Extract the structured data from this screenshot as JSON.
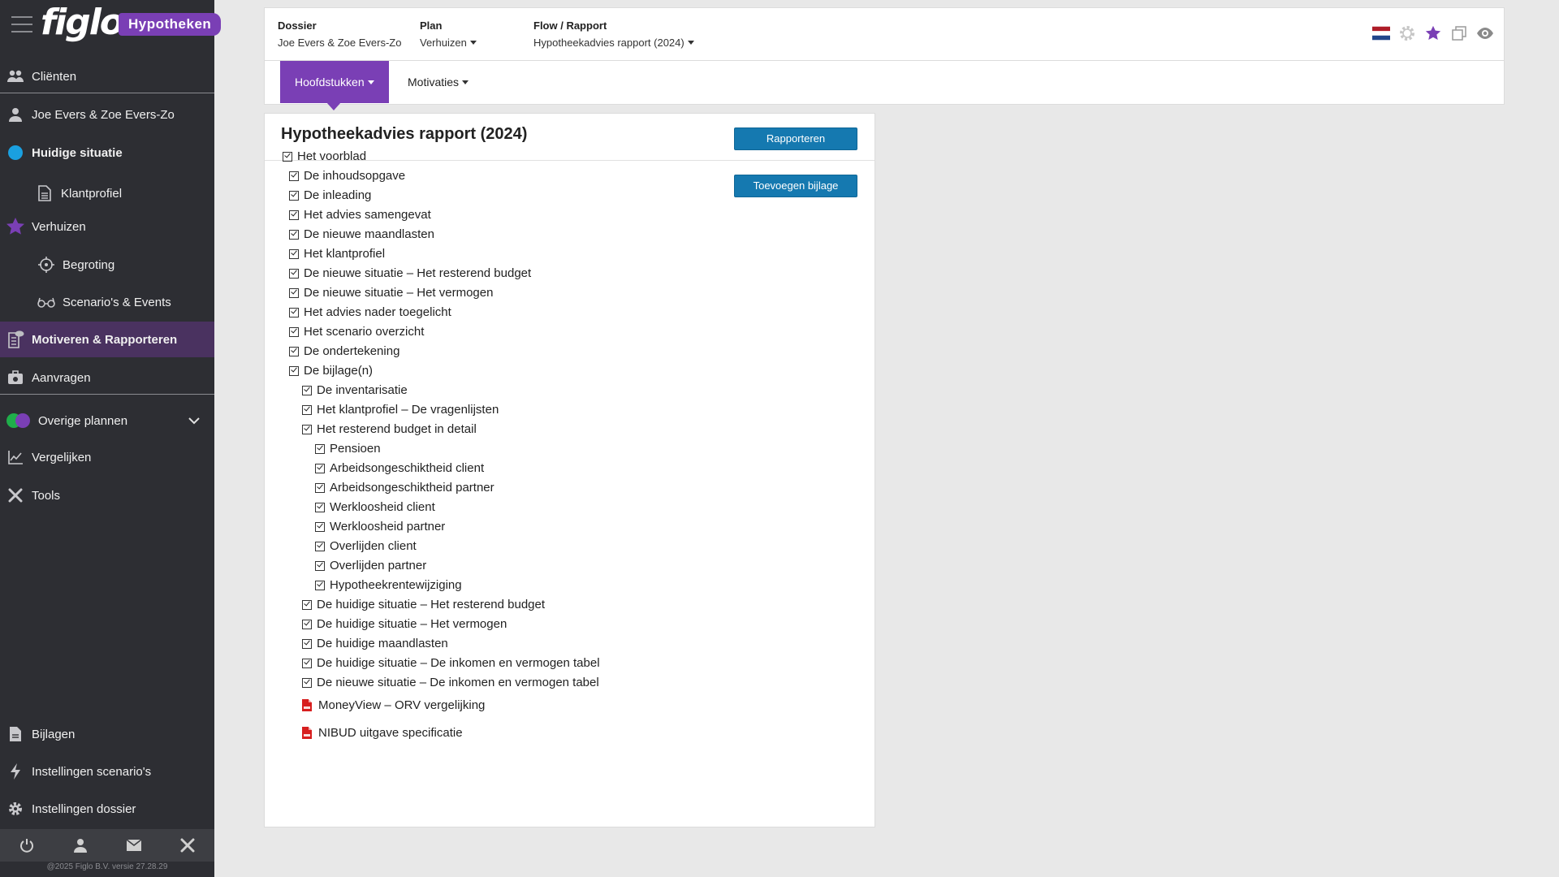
{
  "app": {
    "logo": "figlo",
    "product_badge": "Hypotheken",
    "copyright": "@2025 Figlo B.V. versie 27.28.29"
  },
  "sidebar": {
    "items": [
      {
        "label": "Cliënten",
        "icon": "users-icon"
      },
      {
        "label": "Joe Evers & Zoe Evers-Zo",
        "icon": "user-icon"
      },
      {
        "label": "Huidige situatie",
        "icon": "blue-dot-icon"
      },
      {
        "label": "Klantprofiel",
        "icon": "document-icon"
      },
      {
        "label": "Verhuizen",
        "icon": "star-icon"
      },
      {
        "label": "Begroting",
        "icon": "crosshair-icon"
      },
      {
        "label": "Scenario's & Events",
        "icon": "glasses-icon"
      },
      {
        "label": "Motiveren & Rapporteren",
        "icon": "report-icon"
      },
      {
        "label": "Aanvragen",
        "icon": "send-icon"
      },
      {
        "label": "Overige plannen",
        "icon": "plans-icon"
      },
      {
        "label": "Vergelijken",
        "icon": "chart-line-icon"
      },
      {
        "label": "Tools",
        "icon": "tools-icon"
      },
      {
        "label": "Bijlagen",
        "icon": "file-icon"
      },
      {
        "label": "Instellingen scenario's",
        "icon": "bolt-icon"
      },
      {
        "label": "Instellingen dossier",
        "icon": "gear-icon"
      }
    ]
  },
  "header": {
    "dossier_label": "Dossier",
    "dossier_value": "Joe Evers & Zoe Evers-Zo",
    "plan_label": "Plan",
    "plan_value": "Verhuizen",
    "flow_label": "Flow / Rapport",
    "flow_value": "Hypotheekadvies rapport (2024)"
  },
  "tabs": [
    {
      "label": "Hoofdstukken",
      "active": true
    },
    {
      "label": "Motivaties",
      "active": false
    }
  ],
  "panel": {
    "title": "Hypotheekadvies rapport (2024)",
    "report_button": "Rapporteren",
    "attach_button": "Toevoegen bijlage"
  },
  "chapters": [
    {
      "label": "Het voorblad",
      "level": 0,
      "type": "checkbox"
    },
    {
      "label": "De inhoudsopgave",
      "level": 1,
      "type": "checkbox"
    },
    {
      "label": "De inleading",
      "level": 1,
      "type": "checkbox"
    },
    {
      "label": "Het advies samengevat",
      "level": 1,
      "type": "checkbox"
    },
    {
      "label": "De nieuwe maandlasten",
      "level": 1,
      "type": "checkbox"
    },
    {
      "label": "Het klantprofiel",
      "level": 1,
      "type": "checkbox"
    },
    {
      "label": "De nieuwe situatie – Het resterend budget",
      "level": 1,
      "type": "checkbox"
    },
    {
      "label": "De nieuwe situatie – Het vermogen",
      "level": 1,
      "type": "checkbox"
    },
    {
      "label": "Het advies nader toegelicht",
      "level": 1,
      "type": "checkbox"
    },
    {
      "label": "Het scenario overzicht",
      "level": 1,
      "type": "checkbox"
    },
    {
      "label": "De ondertekening",
      "level": 1,
      "type": "checkbox"
    },
    {
      "label": "De bijlage(n)",
      "level": 1,
      "type": "checkbox"
    },
    {
      "label": "De inventarisatie",
      "level": 2,
      "type": "checkbox"
    },
    {
      "label": "Het klantprofiel – De vragenlijsten",
      "level": 2,
      "type": "checkbox"
    },
    {
      "label": "Het resterend budget in detail",
      "level": 2,
      "type": "checkbox"
    },
    {
      "label": "Pensioen",
      "level": 3,
      "type": "checkbox"
    },
    {
      "label": "Arbeidsongeschiktheid client",
      "level": 3,
      "type": "checkbox"
    },
    {
      "label": "Arbeidsongeschiktheid partner",
      "level": 3,
      "type": "checkbox"
    },
    {
      "label": "Werkloosheid client",
      "level": 3,
      "type": "checkbox"
    },
    {
      "label": "Werkloosheid partner",
      "level": 3,
      "type": "checkbox"
    },
    {
      "label": "Overlijden client",
      "level": 3,
      "type": "checkbox"
    },
    {
      "label": "Overlijden partner",
      "level": 3,
      "type": "checkbox"
    },
    {
      "label": "Hypotheekrentewijziging",
      "level": 3,
      "type": "checkbox"
    },
    {
      "label": "De huidige situatie – Het resterend budget",
      "level": 2,
      "type": "checkbox"
    },
    {
      "label": "De huidige situatie – Het vermogen",
      "level": 2,
      "type": "checkbox"
    },
    {
      "label": "De huidige maandlasten",
      "level": 2,
      "type": "checkbox"
    },
    {
      "label": "De huidige situatie – De inkomen en vermogen tabel",
      "level": 2,
      "type": "checkbox"
    },
    {
      "label": "De nieuwe situatie – De inkomen en vermogen tabel",
      "level": 2,
      "type": "checkbox"
    },
    {
      "label": "MoneyView – ORV vergelijking",
      "level": 2,
      "type": "pdf"
    },
    {
      "label": "NIBUD uitgave specificatie",
      "level": 2,
      "type": "pdf"
    }
  ],
  "colors": {
    "sidebar_bg": "#2d2e33",
    "accent_purple": "#7a3fb5",
    "button_blue": "#1579b0",
    "status_blue": "#1aa0e0"
  }
}
